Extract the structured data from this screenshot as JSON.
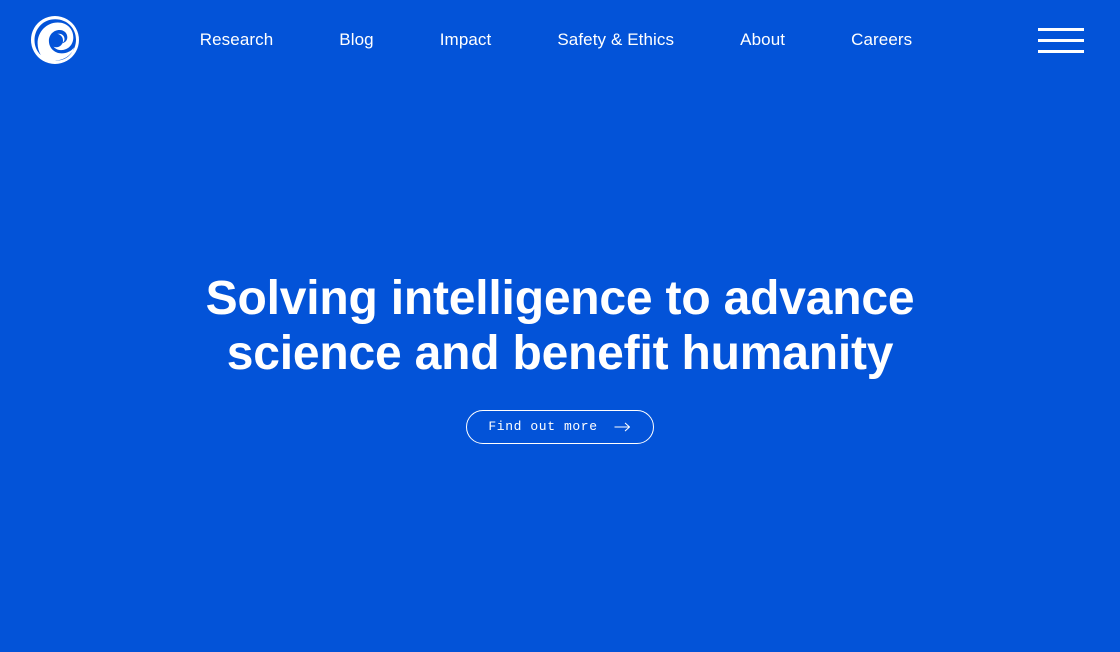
{
  "theme": {
    "background": "#0353d8",
    "foreground": "#ffffff",
    "accent": "#0353d8"
  },
  "header": {
    "logo": {
      "icon": "deepmind-spiral-logo",
      "alt": "DeepMind"
    },
    "nav": [
      {
        "label": "Research"
      },
      {
        "label": "Blog"
      },
      {
        "label": "Impact"
      },
      {
        "label": "Safety & Ethics"
      },
      {
        "label": "About"
      },
      {
        "label": "Careers"
      }
    ],
    "menu_toggle": {
      "icon": "hamburger-menu-icon",
      "label": "Menu"
    }
  },
  "hero": {
    "heading": "Solving intelligence to advance science and benefit humanity",
    "cta": {
      "label": "Find out more",
      "icon": "arrow-right-icon"
    }
  }
}
